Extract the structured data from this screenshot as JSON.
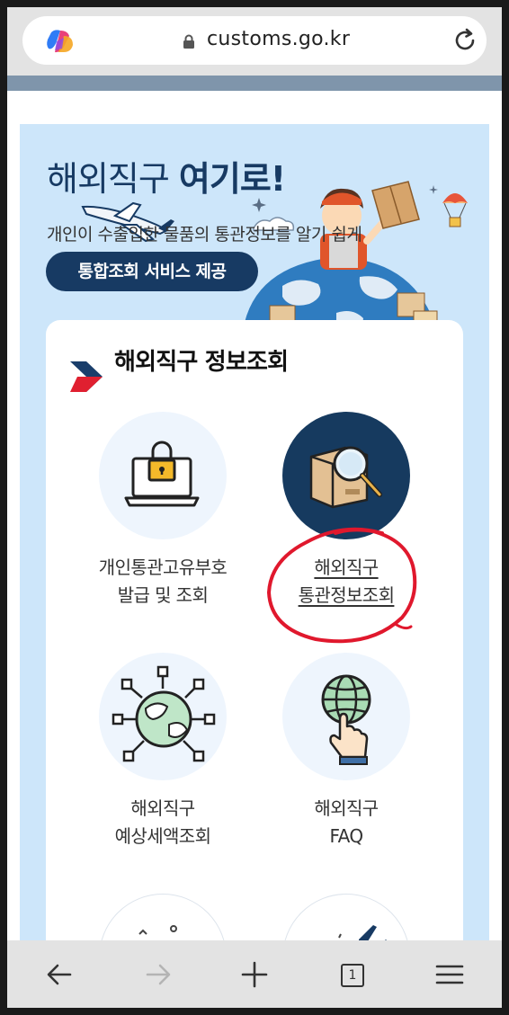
{
  "browser": {
    "url": "customs.go.kr",
    "tab_count": "1"
  },
  "banner": {
    "headline_normal": "해외직구 ",
    "headline_bold": "여기로!",
    "subline": "개인이 수출입한 물품의 통관정보를 알기 쉽게",
    "pill": "통합조회 서비스 제공"
  },
  "card": {
    "title": "해외직구 정보조회",
    "items": [
      {
        "line1": "개인통관고유부호",
        "line2": "발급 및 조회",
        "icon": "laptop-lock-icon"
      },
      {
        "line1": "해외직구",
        "line2": "통관정보조회",
        "icon": "box-magnifier-icon"
      },
      {
        "line1": "해외직구",
        "line2": "예상세액조회",
        "icon": "globe-network-icon"
      },
      {
        "line1": "해외직구",
        "line2": "FAQ",
        "icon": "globe-hand-icon"
      }
    ]
  },
  "colors": {
    "navy": "#173a63",
    "banner_bg": "#cde6fa",
    "annotation_red": "#e0182d"
  }
}
